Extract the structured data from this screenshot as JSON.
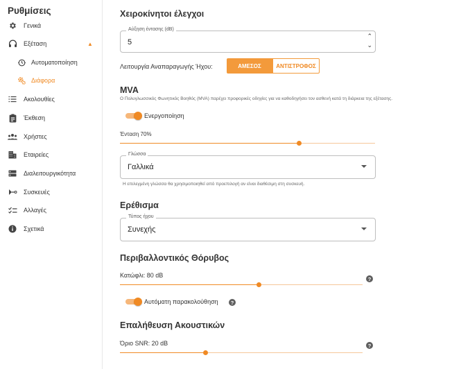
{
  "sidebar": {
    "title": "Ρυθμίσεις",
    "items": [
      {
        "label": "Γενικά",
        "icon": "gear-icon"
      },
      {
        "label": "Εξέταση",
        "icon": "headphones-icon"
      },
      {
        "label": "Αυτοματοποίηση",
        "icon": "automation-icon"
      },
      {
        "label": "Διάφορα",
        "icon": "gears-icon"
      },
      {
        "label": "Ακολουθίες",
        "icon": "list-icon"
      },
      {
        "label": "Έκθεση",
        "icon": "report-icon"
      },
      {
        "label": "Χρήστες",
        "icon": "users-icon"
      },
      {
        "label": "Εταιρείες",
        "icon": "building-icon"
      },
      {
        "label": "Διαλειτουργικότητα",
        "icon": "interop-icon"
      },
      {
        "label": "Συσκευές",
        "icon": "devices-icon"
      },
      {
        "label": "Αλλαγές",
        "icon": "changes-icon"
      },
      {
        "label": "Σχετικά",
        "icon": "info-icon"
      }
    ],
    "accent": "#f08a24"
  },
  "manual": {
    "heading": "Χειροκίνητοι έλεγχοι",
    "gain_label": "Αύξηση έντασης (dB)",
    "gain_value": "5",
    "mode_label": "Λειτουργία Αναπαραγωγής Ήχου:",
    "mode_on": "ΑΜΕΣΟΣ",
    "mode_off": "ΑΝΤΙΣΤΡΟΦΟΣ"
  },
  "mva": {
    "heading": "MVA",
    "description": "Ο Πολυγλωσσικός Φωνητικός Βοηθός (MVA) παρέχει προφορικές οδηγίες για να καθοδηγήσει τον ασθενή κατά τη διάρκεια της εξέτασης.",
    "enable_label": "Ενεργοποίηση",
    "enabled": true,
    "volume_label": "Ένταση 70%",
    "volume_value": 0.7,
    "language_legend": "Γλώσσα",
    "language_value": "Γαλλικά",
    "language_help": "Η επιλεγμένη γλώσσα θα χρησιμοποιηθεί από προεπιλογή αν είναι διαθέσιμη στη συσκευή."
  },
  "stimulus": {
    "heading": "Ερέθισμα",
    "type_legend": "Τύπος ήχου",
    "type_value": "Συνεχής"
  },
  "noise": {
    "heading": "Περιβαλλοντικός Θόρυβος",
    "threshold_label": "Κατώφλι: 80 dB",
    "threshold_value": 0.57,
    "auto_label": "Αυτόματη παρακολούθηση",
    "auto_enabled": true
  },
  "calibration": {
    "heading": "Επαλήθευση Ακουστικών",
    "snr_label": "Όριο SNR: 20 dB",
    "snr_value": 0.35
  },
  "help_glyph": "?"
}
